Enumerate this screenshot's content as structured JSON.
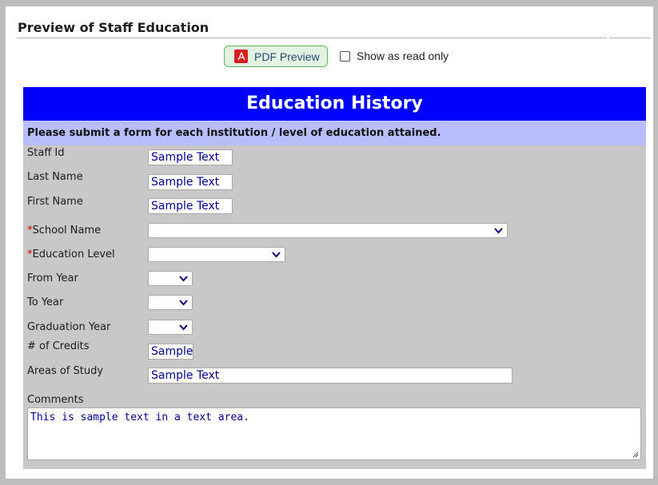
{
  "page": {
    "title": "Preview of Staff Education",
    "pdf_button_label": "PDF Preview",
    "read_only_label": "Show as read only"
  },
  "form": {
    "header": "Education History",
    "instructions": "Please submit a form for each institution / level of education attained.",
    "fields": {
      "staff_id": {
        "label": "Staff Id",
        "value": "Sample Text"
      },
      "last_name": {
        "label": "Last Name",
        "value": "Sample Text"
      },
      "first_name": {
        "label": "First Name",
        "value": "Sample Text"
      },
      "school_name": {
        "label": "School Name",
        "required_mark": "*",
        "value": ""
      },
      "education_level": {
        "label": "Education Level",
        "required_mark": "*",
        "value": ""
      },
      "from_year": {
        "label": "From Year",
        "value": ""
      },
      "to_year": {
        "label": "To Year",
        "value": ""
      },
      "graduation_year": {
        "label": "Graduation Year",
        "value": ""
      },
      "credits": {
        "label": "# of Credits",
        "value": "Sample"
      },
      "areas_of_study": {
        "label": "Areas of Study",
        "value": "Sample Text"
      },
      "comments": {
        "label": "Comments",
        "value": "This is sample text in a text area."
      }
    }
  },
  "colors": {
    "header_bg": "#0000ff",
    "instructions_bg": "#b8bdfc",
    "form_bg": "#c8c8c8",
    "input_text": "#00008b",
    "required": "#d40000"
  },
  "icons": {
    "pdf": "pdf-file-icon",
    "dropdown": "chevron-down-icon",
    "resize": "resize-grip-icon"
  }
}
